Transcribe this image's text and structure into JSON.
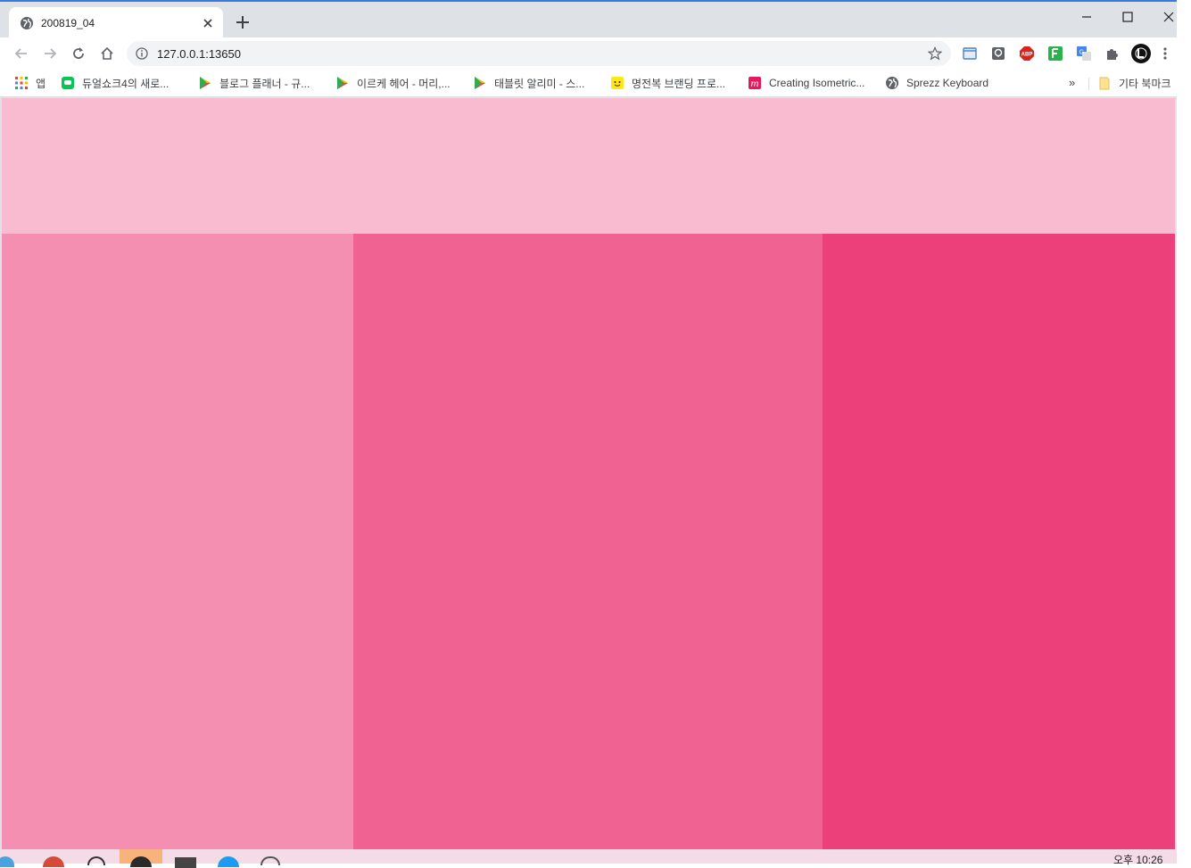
{
  "tab": {
    "title": "200819_04"
  },
  "omnibox": {
    "url": "127.0.0.1:13650"
  },
  "bookmarks": [
    {
      "label": "앱",
      "icon": "apps-grid-icon"
    },
    {
      "label": "듀얼쇼크4의 새로...",
      "icon": "line-chat-icon"
    },
    {
      "label": "블로그 플래너 - 규...",
      "icon": "play-store-icon"
    },
    {
      "label": "이르케 헤어 - 머리,...",
      "icon": "play-store-icon"
    },
    {
      "label": "태블릿 알리미 - 스...",
      "icon": "play-store-icon"
    },
    {
      "label": "명전복 브랜딩 프로...",
      "icon": "smiley-icon"
    },
    {
      "label": "Creating Isometric...",
      "icon": "m-logo-icon"
    },
    {
      "label": "Sprezz Keyboard",
      "icon": "globe-icon"
    }
  ],
  "other_bookmarks": "기타 북마크",
  "page": {
    "header_color": "#f8bbd0",
    "columns": [
      {
        "color": "#f48fb1"
      },
      {
        "color": "#f06292"
      },
      {
        "color": "#ec407a"
      }
    ]
  },
  "taskbar": {
    "clock": "오후 10:26"
  }
}
